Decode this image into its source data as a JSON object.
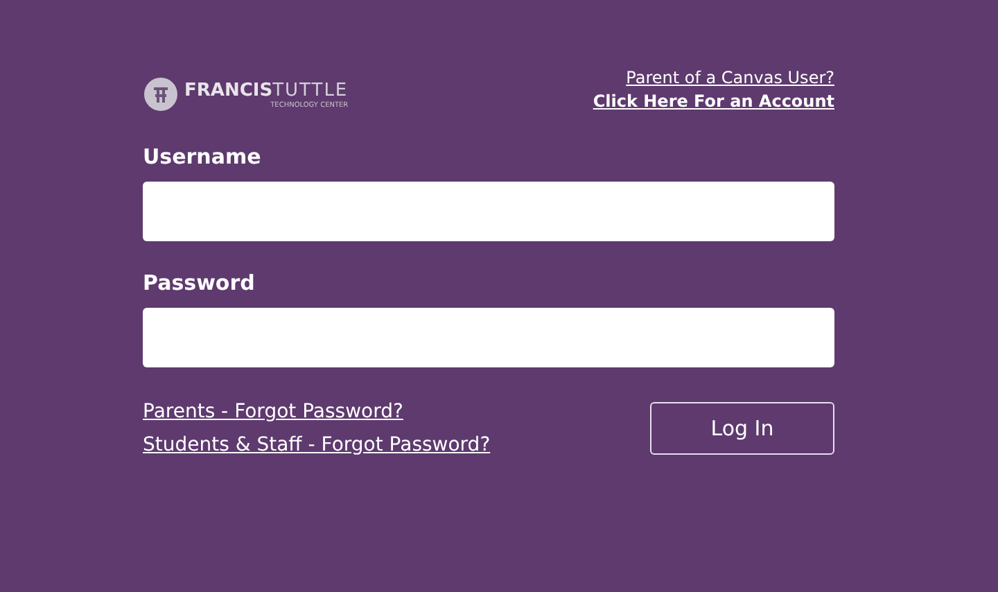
{
  "logo": {
    "word_1": "FRANCIS",
    "word_2": "TUTTLE",
    "tagline": "TECHNOLOGY CENTER"
  },
  "parent_links": [
    "Parent of a Canvas User?",
    "Click Here For an Account"
  ],
  "fields": [
    {
      "label": "Username"
    },
    {
      "label": "Password"
    }
  ],
  "forgot_links": [
    "Parents - Forgot Password?",
    "Students & Staff - Forgot Password?"
  ],
  "login_button": "Log In"
}
